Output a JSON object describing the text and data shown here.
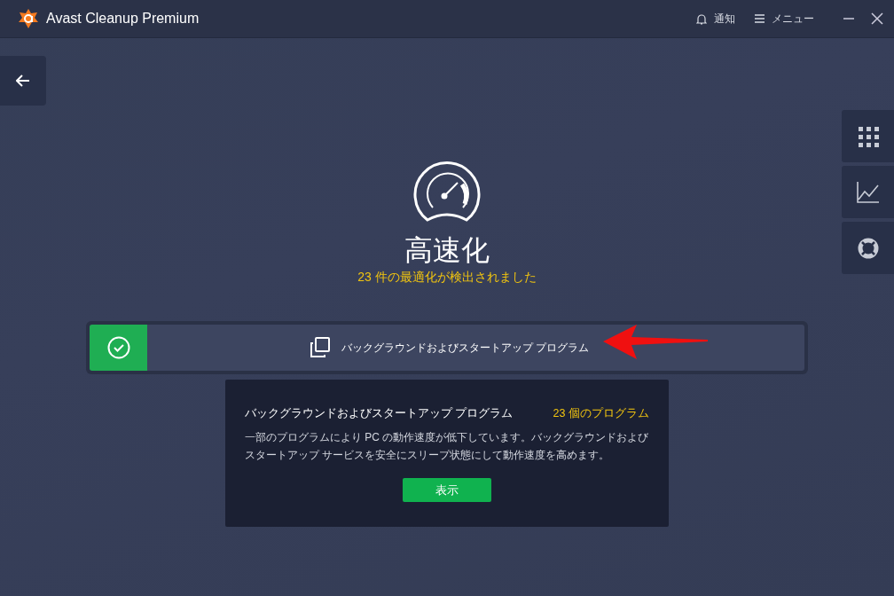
{
  "window": {
    "title": "Avast Cleanup Premium"
  },
  "header_actions": [
    {
      "kind": "bell",
      "label": "通知"
    },
    {
      "kind": "menu",
      "label": "メニュー"
    }
  ],
  "heading": "高速化",
  "subtitle": "23 件の最適化が検出されました",
  "item": {
    "label": "バックグラウンドおよびスタートアップ プログラム",
    "checked": true
  },
  "popup": {
    "title": "バックグラウンドおよびスタートアップ プログラム",
    "count": "23 個のプログラム",
    "description": "一部のプログラムにより PC の動作速度が低下しています。バックグラウンドおよびスタートアップ サービスを安全にスリープ状態にして動作速度を高めます。",
    "button": "表示"
  }
}
